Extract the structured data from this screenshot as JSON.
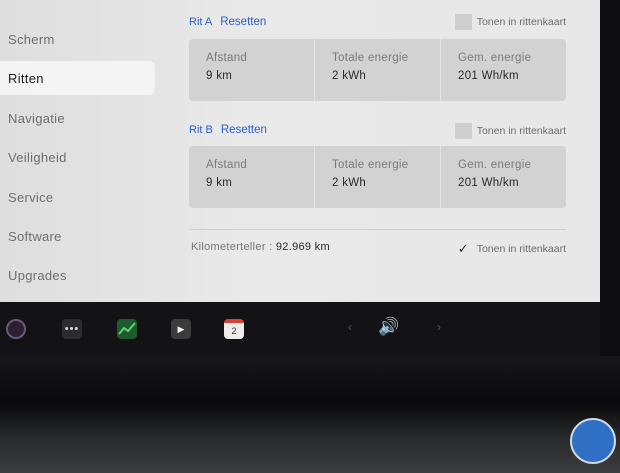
{
  "sidebar": {
    "items": [
      {
        "label": "Scherm",
        "active": false
      },
      {
        "label": "Ritten",
        "active": true
      },
      {
        "label": "Navigatie",
        "active": false
      },
      {
        "label": "Veiligheid",
        "active": false
      },
      {
        "label": "Service",
        "active": false
      },
      {
        "label": "Software",
        "active": false
      },
      {
        "label": "Upgrades",
        "active": false
      }
    ]
  },
  "tripA": {
    "title": "Rit A",
    "reset": "Resetten",
    "toggle_label": "Tonen in rittenkaart",
    "toggle_checked": false,
    "stats": [
      {
        "label": "Afstand",
        "value": "9 km"
      },
      {
        "label": "Totale energie",
        "value": "2 kWh"
      },
      {
        "label": "Gem. energie",
        "value": "201 Wh/km"
      }
    ]
  },
  "tripB": {
    "title": "Rit B",
    "reset": "Resetten",
    "toggle_label": "Tonen in rittenkaart",
    "toggle_checked": false,
    "stats": [
      {
        "label": "Afstand",
        "value": "9 km"
      },
      {
        "label": "Totale energie",
        "value": "2 kWh"
      },
      {
        "label": "Gem. energie",
        "value": "201 Wh/km"
      }
    ]
  },
  "odometer": {
    "label": "Kilometerteller :",
    "value": "92.969 km",
    "toggle_label": "Tonen in rittenkaart",
    "toggle_checked": true
  },
  "dock": {
    "more_glyph": "•••",
    "media_glyph": "▶",
    "calendar_day": "2",
    "prev_glyph": "‹",
    "next_glyph": "›",
    "volume_glyph": "🔊"
  },
  "colors": {
    "accent": "#2c5fd0",
    "panel": "#d2d2d2",
    "screen": "#e6e6e6"
  }
}
